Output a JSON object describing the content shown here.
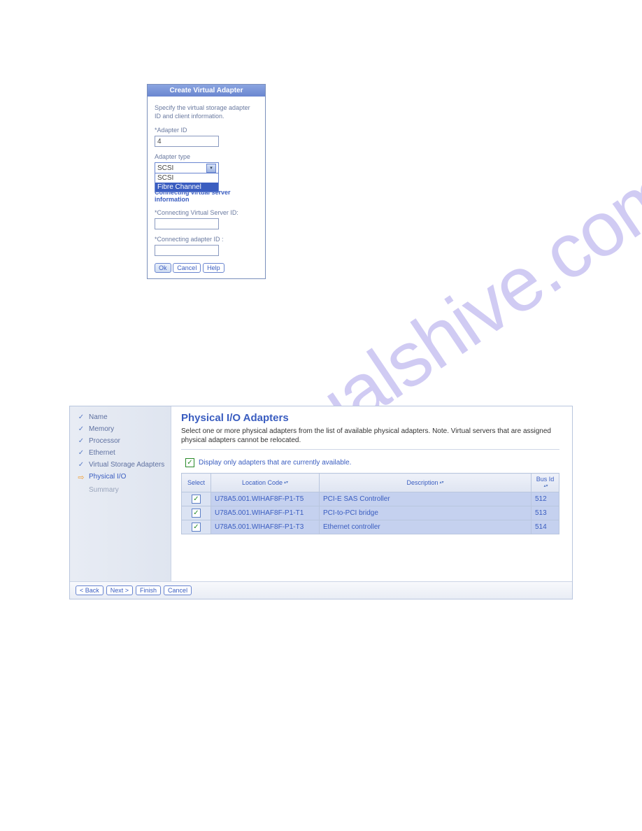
{
  "watermark": "manualshive.com",
  "dialog": {
    "title": "Create Virtual Adapter",
    "instruction": "Specify the virtual storage adapter ID and client information.",
    "adapter_id_label": "*Adapter ID",
    "adapter_id_value": "4",
    "adapter_type_label": "Adapter type",
    "adapter_type_selected": "SCSI",
    "adapter_type_options": [
      "SCSI",
      "Fibre Channel"
    ],
    "adapter_type_highlighted": "Fibre Channel",
    "section_heading": "Connecting virtual server information",
    "conn_server_label": "*Connecting Virtual Server ID:",
    "conn_server_value": "",
    "conn_adapter_label": "*Connecting adapter ID :",
    "conn_adapter_value": "",
    "ok_label": "Ok",
    "cancel_label": "Cancel",
    "help_label": "Help"
  },
  "wizard": {
    "steps": [
      {
        "label": "Name",
        "state": "done"
      },
      {
        "label": "Memory",
        "state": "done"
      },
      {
        "label": "Processor",
        "state": "done"
      },
      {
        "label": "Ethernet",
        "state": "done"
      },
      {
        "label": "Virtual Storage Adapters",
        "state": "done"
      },
      {
        "label": "Physical I/O",
        "state": "current"
      },
      {
        "label": "Summary",
        "state": "future"
      }
    ],
    "title": "Physical I/O Adapters",
    "instruction": "Select one or more physical adapters from the list of available physical adapters. Note. Virtual servers that are assigned physical adapters cannot be relocated.",
    "display_only_label": "Display only adapters that are currently available.",
    "columns": {
      "select": "Select",
      "location": "Location Code",
      "description": "Description",
      "bus_id": "Bus Id"
    },
    "rows": [
      {
        "selected": true,
        "location": "U78A5.001.WIHAF8F-P1-T5",
        "description": "PCI-E SAS Controller",
        "bus_id": "512"
      },
      {
        "selected": true,
        "location": "U78A5.001.WIHAF8F-P1-T1",
        "description": "PCI-to-PCI bridge",
        "bus_id": "513"
      },
      {
        "selected": true,
        "location": "U78A5.001.WIHAF8F-P1-T3",
        "description": "Ethernet controller",
        "bus_id": "514"
      }
    ],
    "footer": {
      "back": "< Back",
      "next": "Next >",
      "finish": "Finish",
      "cancel": "Cancel"
    }
  }
}
